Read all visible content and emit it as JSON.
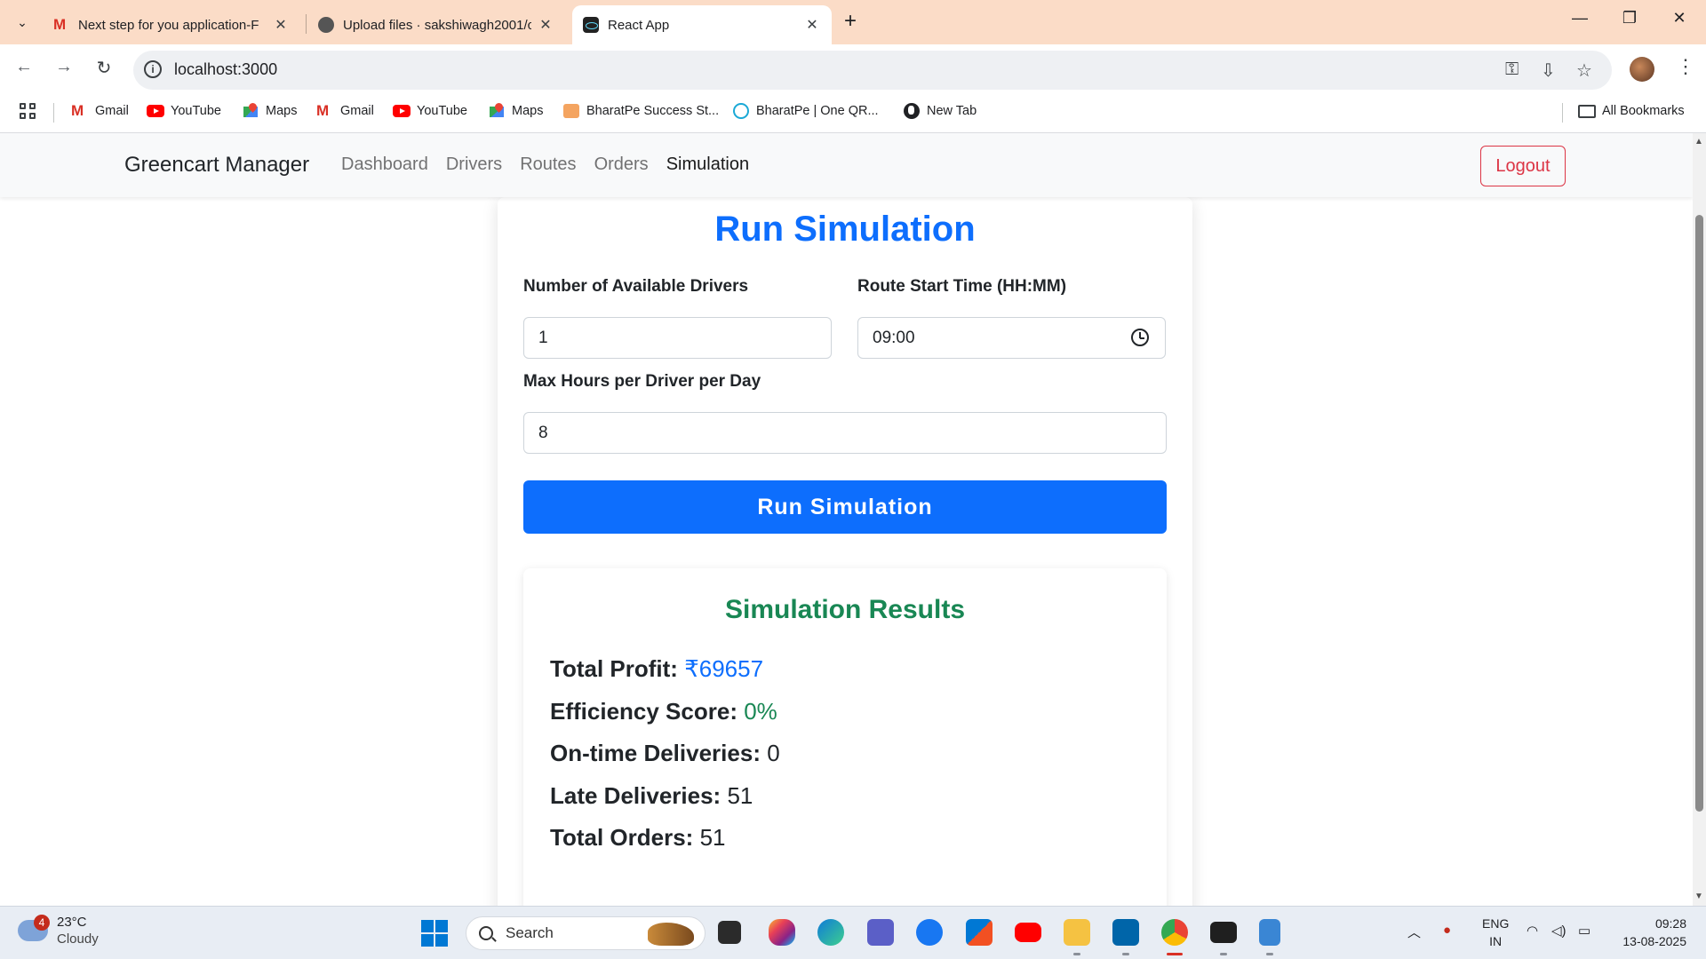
{
  "browser": {
    "tabs": [
      {
        "title": "Next step for you application-F",
        "icon": "gmail-icon",
        "active": false
      },
      {
        "title": "Upload files · sakshiwagh2001/c",
        "icon": "github-icon",
        "active": false
      },
      {
        "title": "React App",
        "icon": "react-icon",
        "active": true
      }
    ],
    "url": "localhost:3000",
    "bookmarks": [
      {
        "label": "Gmail",
        "icon": "gmail-icon"
      },
      {
        "label": "YouTube",
        "icon": "youtube-icon"
      },
      {
        "label": "Maps",
        "icon": "maps-icon"
      },
      {
        "label": "Gmail",
        "icon": "gmail-icon"
      },
      {
        "label": "YouTube",
        "icon": "youtube-icon"
      },
      {
        "label": "Maps",
        "icon": "maps-icon"
      },
      {
        "label": "BharatPe Success St...",
        "icon": "bharatpe-story-icon"
      },
      {
        "label": "BharatPe | One QR...",
        "icon": "bharatpe-icon"
      },
      {
        "label": "New Tab",
        "icon": "globe-icon"
      }
    ],
    "all_bookmarks_label": "All Bookmarks"
  },
  "app": {
    "brand": "Greencart Manager",
    "nav": [
      "Dashboard",
      "Drivers",
      "Routes",
      "Orders",
      "Simulation"
    ],
    "active_nav": "Simulation",
    "logout_label": "Logout"
  },
  "simulation": {
    "title": "Run Simulation",
    "drivers_label": "Number of Available Drivers",
    "drivers_value": "1",
    "start_time_label": "Route Start Time (HH:MM)",
    "start_time_value": "09:00",
    "max_hours_label": "Max Hours per Driver per Day",
    "max_hours_value": "8",
    "run_button_label": "Run Simulation"
  },
  "results": {
    "title": "Simulation Results",
    "rows": [
      {
        "label": "Total Profit:",
        "value": "₹69657",
        "color": "#0d6efd"
      },
      {
        "label": "Efficiency Score:",
        "value": "0%",
        "color": "#198754"
      },
      {
        "label": "On-time Deliveries:",
        "value": "0",
        "color": "#212529"
      },
      {
        "label": "Late Deliveries:",
        "value": "51",
        "color": "#212529"
      },
      {
        "label": "Total Orders:",
        "value": "51",
        "color": "#212529"
      }
    ]
  },
  "taskbar": {
    "weather_temp": "23°C",
    "weather_desc": "Cloudy",
    "weather_badge": "4",
    "search_placeholder": "Search",
    "lang_line1": "ENG",
    "lang_line2": "IN",
    "time": "09:28",
    "date": "13-08-2025"
  },
  "colors": {
    "primary": "#0d6efd",
    "success": "#198754",
    "danger": "#dc3545",
    "tabstrip": "#fbdcc7"
  }
}
